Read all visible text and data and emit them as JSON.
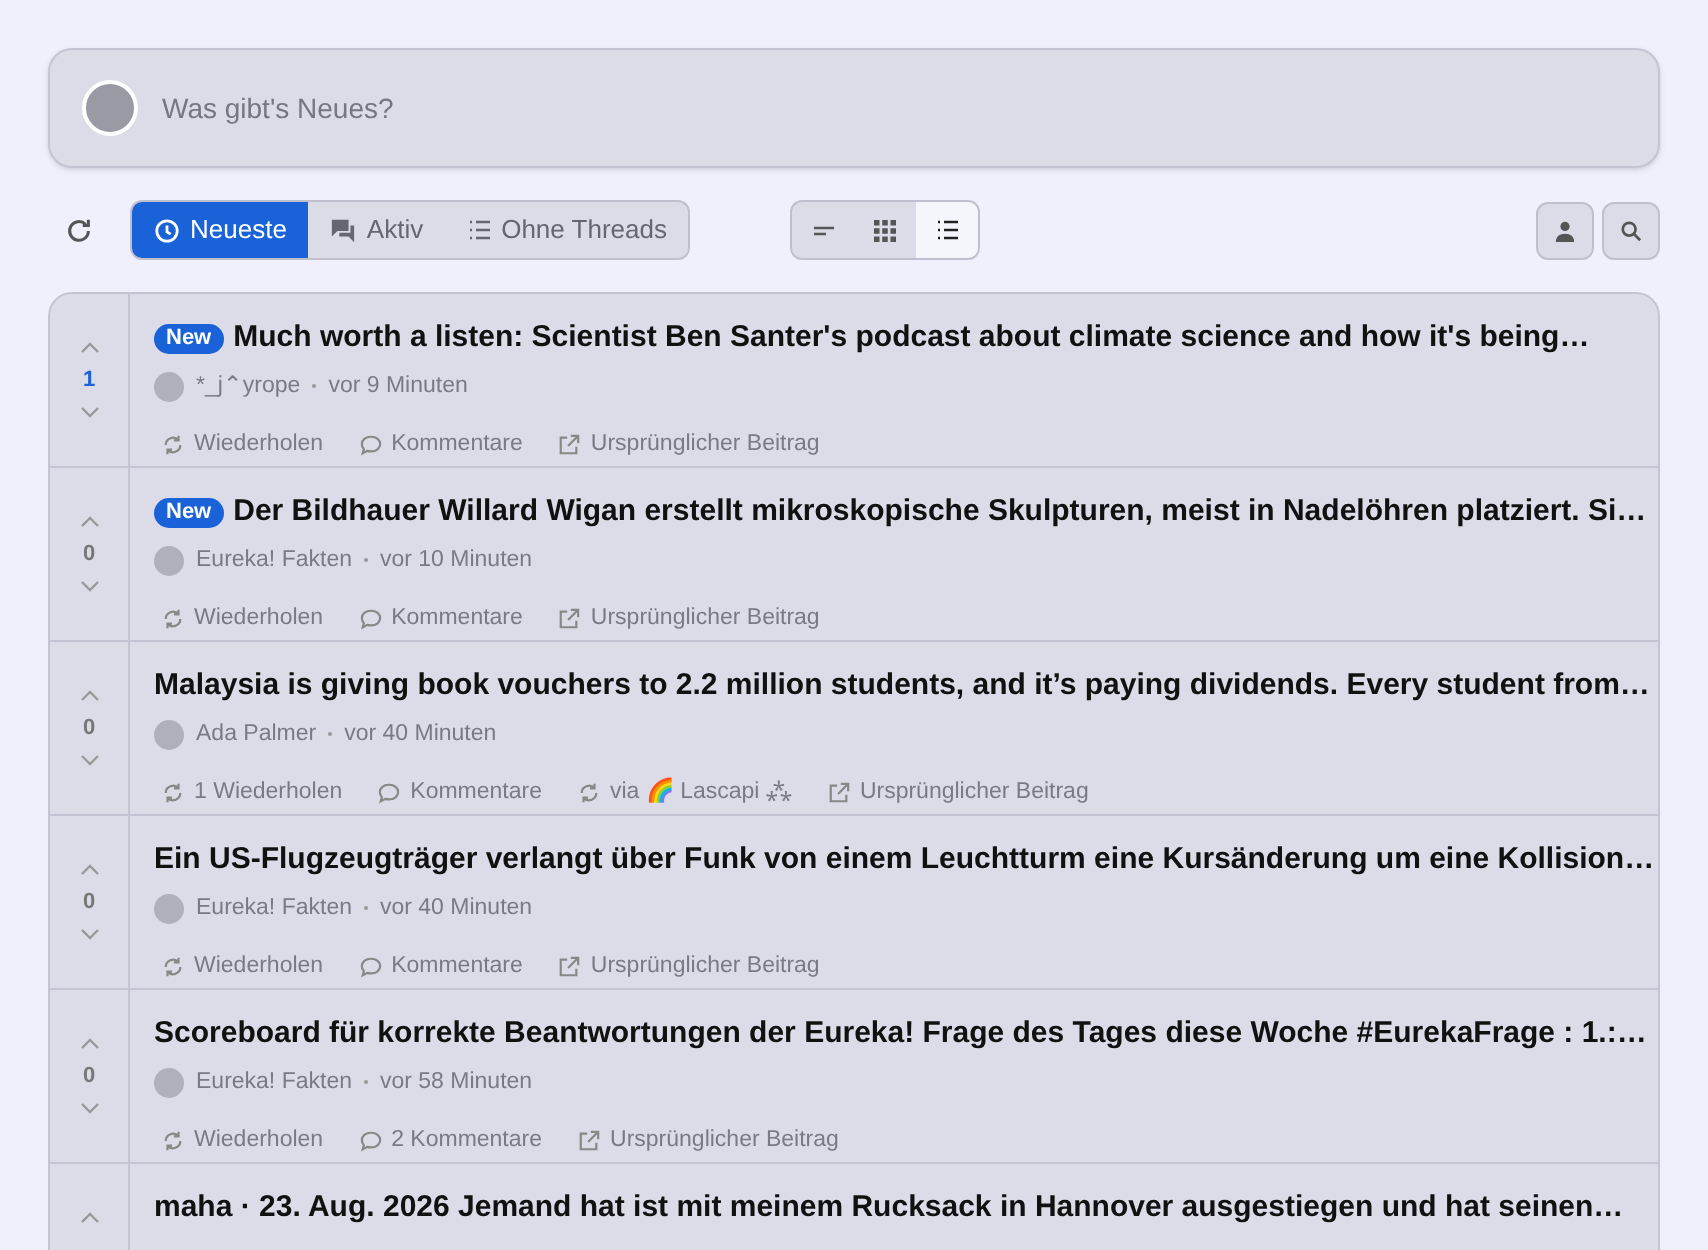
{
  "composer": {
    "placeholder": "Was gibt's Neues?"
  },
  "feed_tabs": [
    {
      "label": "Neueste",
      "selected": true
    },
    {
      "label": "Aktiv",
      "selected": false
    },
    {
      "label": "Ohne Threads",
      "selected": false
    }
  ],
  "view_modes": [
    {
      "selected": false
    },
    {
      "selected": false
    },
    {
      "selected": true
    }
  ],
  "posts": [
    {
      "votes": "1",
      "voted": true,
      "new_badge": "New",
      "title": "Much worth a listen: Scientist Ben Santer's podcast about climate science and how it's being…",
      "author": "*_j⌃yrope",
      "time": "vor 9 Minuten",
      "actions": [
        {
          "kind": "repost",
          "label": "Wiederholen"
        },
        {
          "kind": "comments",
          "label": "Kommentare"
        },
        {
          "kind": "original",
          "label": "Ursprünglicher Beitrag"
        }
      ]
    },
    {
      "votes": "0",
      "voted": false,
      "new_badge": "New",
      "title": "Der Bildhauer Willard Wigan erstellt mikroskopische Skulpturen, meist in Nadelöhren platziert. Si…",
      "author": "Eureka! Fakten",
      "time": "vor 10 Minuten",
      "actions": [
        {
          "kind": "repost",
          "label": "Wiederholen"
        },
        {
          "kind": "comments",
          "label": "Kommentare"
        },
        {
          "kind": "original",
          "label": "Ursprünglicher Beitrag"
        }
      ]
    },
    {
      "votes": "0",
      "voted": false,
      "title": "Malaysia is giving book vouchers to 2.2 million students, and it’s paying dividends. Every student from…",
      "author": "Ada Palmer",
      "time": "vor 40 Minuten",
      "actions": [
        {
          "kind": "repost",
          "label": "1 Wiederholen"
        },
        {
          "kind": "comments",
          "label": "Kommentare"
        },
        {
          "kind": "via",
          "label": "via 🌈 Lascapi ⁂"
        },
        {
          "kind": "original",
          "label": "Ursprünglicher Beitrag"
        }
      ]
    },
    {
      "votes": "0",
      "voted": false,
      "title": "Ein US-Flugzeugträger verlangt über Funk von einem Leuchtturm eine Kursänderung um eine Kollision…",
      "author": "Eureka! Fakten",
      "time": "vor 40 Minuten",
      "actions": [
        {
          "kind": "repost",
          "label": "Wiederholen"
        },
        {
          "kind": "comments",
          "label": "Kommentare"
        },
        {
          "kind": "original",
          "label": "Ursprünglicher Beitrag"
        }
      ]
    },
    {
      "votes": "0",
      "voted": false,
      "title": "Scoreboard für korrekte Beantwortungen der Eureka! Frage des Tages diese Woche #EurekaFrage : 1.:…",
      "author": "Eureka! Fakten",
      "time": "vor 58 Minuten",
      "actions": [
        {
          "kind": "repost",
          "label": "Wiederholen"
        },
        {
          "kind": "comments",
          "label": "2 Kommentare"
        },
        {
          "kind": "original",
          "label": "Ursprünglicher Beitrag"
        }
      ]
    },
    {
      "title": "maha · 23. Aug. 2026 Jemand hat ist mit meinem Rucksack in Hannover ausgestiegen und hat seinen…"
    }
  ]
}
